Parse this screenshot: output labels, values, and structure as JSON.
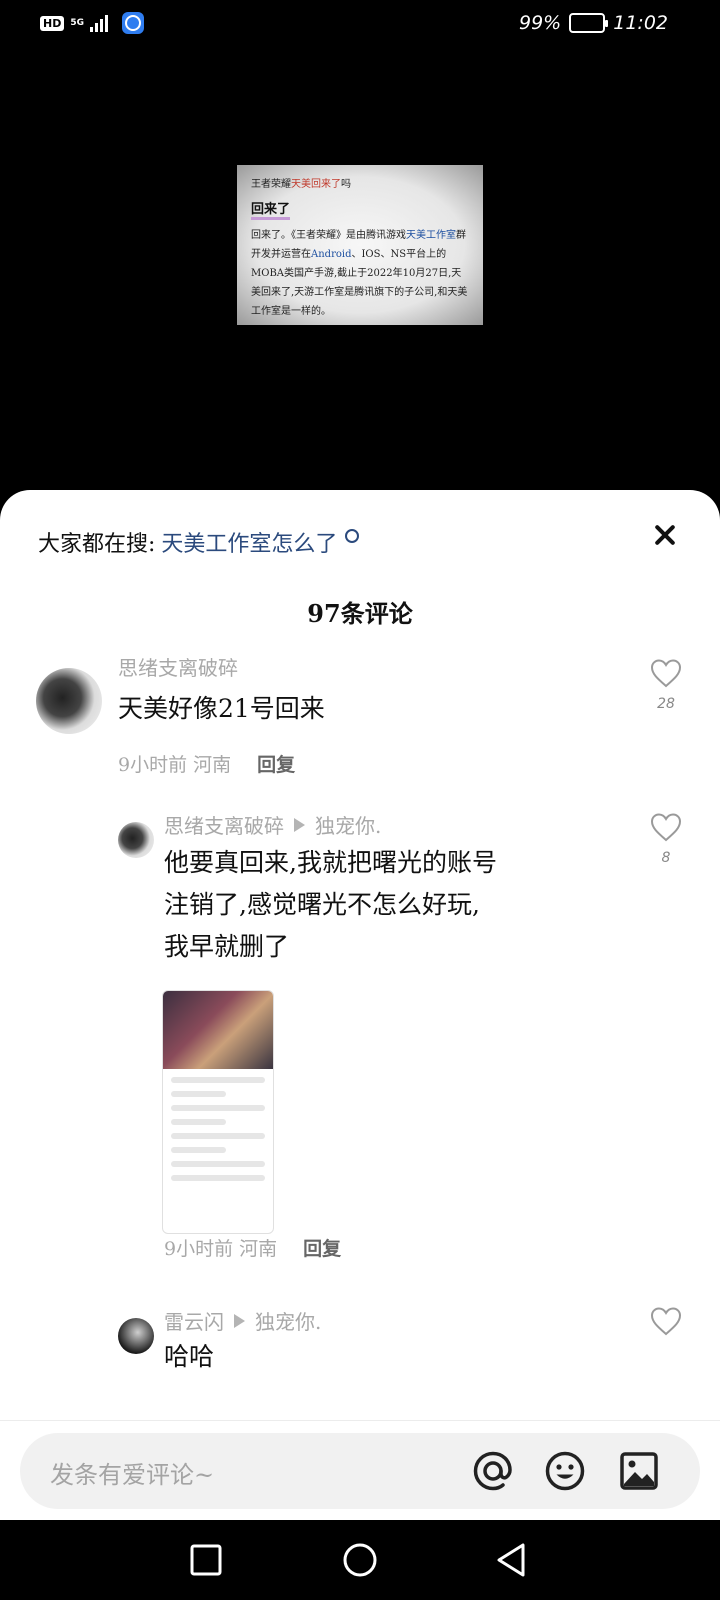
{
  "status_bar": {
    "hd": "HD",
    "network": "5G",
    "battery": "99%",
    "battery_level": 0.99,
    "time": "11:02"
  },
  "preview_card": {
    "title_prefix": "王者荣耀",
    "title_highlight": "天美回来了",
    "title_suffix": "吗",
    "heading": "回来了",
    "body_1": "回来了。《王者荣耀》是由腾讯游戏",
    "body_link_1": "天美工作室",
    "body_2": "群开发并运营在",
    "body_link_2": "Android",
    "body_3": "、IOS、NS平台上的MOBA类国产手游,截止于2022年10月27日,天美回来了,天游工作室是腾讯旗下的子公司,和天美工作室是一样的。"
  },
  "sheet": {
    "search_prefix": "大家都在搜:",
    "search_term": "天美工作室怎么了",
    "title": "97条评论"
  },
  "comments": [
    {
      "author": "思绪支离破碎",
      "text": "天美好像21号回来",
      "time": "9小时前",
      "location": "河南",
      "reply_label": "回复",
      "likes": "28"
    }
  ],
  "replies": [
    {
      "author": "思绪支离破碎",
      "reply_to": "独宠你.",
      "text_line_1": "他要真回来,我就把曙光的账号",
      "text_line_2": "注销了,感觉曙光不怎么好玩,",
      "text_line_3": "我早就删了",
      "time": "9小时前",
      "location": "河南",
      "reply_label": "回复",
      "likes": "8"
    },
    {
      "author": "雷云闪",
      "reply_to": "独宠你.",
      "text": "哈哈"
    }
  ],
  "input": {
    "placeholder": "发条有爱评论~"
  },
  "colors": {
    "accent_link": "#2b4a7d",
    "muted": "#a8a8a8"
  }
}
